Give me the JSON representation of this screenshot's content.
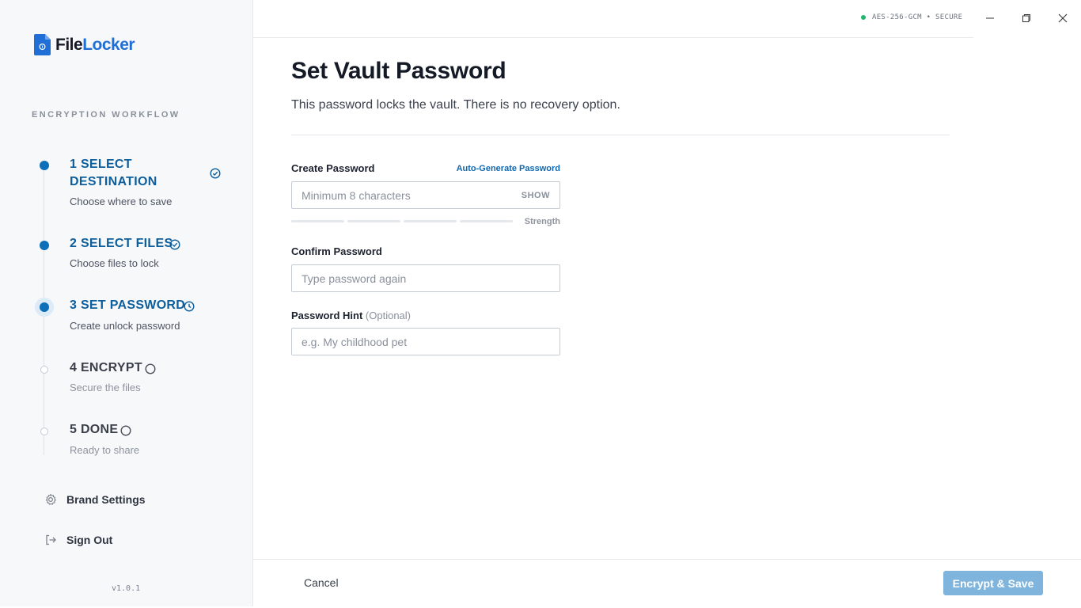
{
  "app": {
    "logo_part1": "File",
    "logo_part2": "Locker",
    "version": "v1.0.1",
    "status": "AES-256-GCM • SECURE"
  },
  "sidebar": {
    "section_label": "ENCRYPTION WORKFLOW",
    "steps": [
      {
        "title_line1": "1 SELECT",
        "title_line2": "DESTINATION",
        "subtitle": "Choose where to save",
        "state": "complete"
      },
      {
        "title": "2 SELECT FILES",
        "subtitle": "Choose files to lock",
        "state": "complete"
      },
      {
        "title": "3 SET PASSWORD",
        "subtitle": "Create unlock password",
        "state": "current"
      },
      {
        "title": "4 ENCRYPT",
        "subtitle": "Secure the files",
        "state": "pending"
      },
      {
        "title": "5 DONE",
        "subtitle": "Ready to share",
        "state": "pending"
      }
    ],
    "links": [
      {
        "label": "Brand Settings",
        "icon": "gear-icon"
      },
      {
        "label": "Sign Out",
        "icon": "sign-out-icon"
      }
    ]
  },
  "main": {
    "title": "Set Vault Password",
    "subtitle": "This password locks the vault. There is no recovery option.",
    "create_password": {
      "label": "Create Password",
      "auto_generate": "Auto-Generate Password",
      "placeholder": "Minimum 8 characters",
      "show_label": "SHOW",
      "strength_label": "Strength",
      "strength_level": 0
    },
    "confirm_password": {
      "label": "Confirm Password",
      "placeholder": "Type password again"
    },
    "password_hint": {
      "label": "Password Hint",
      "optional": "(Optional)",
      "placeholder": "e.g. My childhood pet"
    }
  },
  "footer": {
    "cancel": "Cancel",
    "primary": "Encrypt & Save"
  },
  "colors": {
    "accent": "#0d6fb8",
    "primary_disabled": "#7fb5dc",
    "secure": "#1fb86a"
  }
}
